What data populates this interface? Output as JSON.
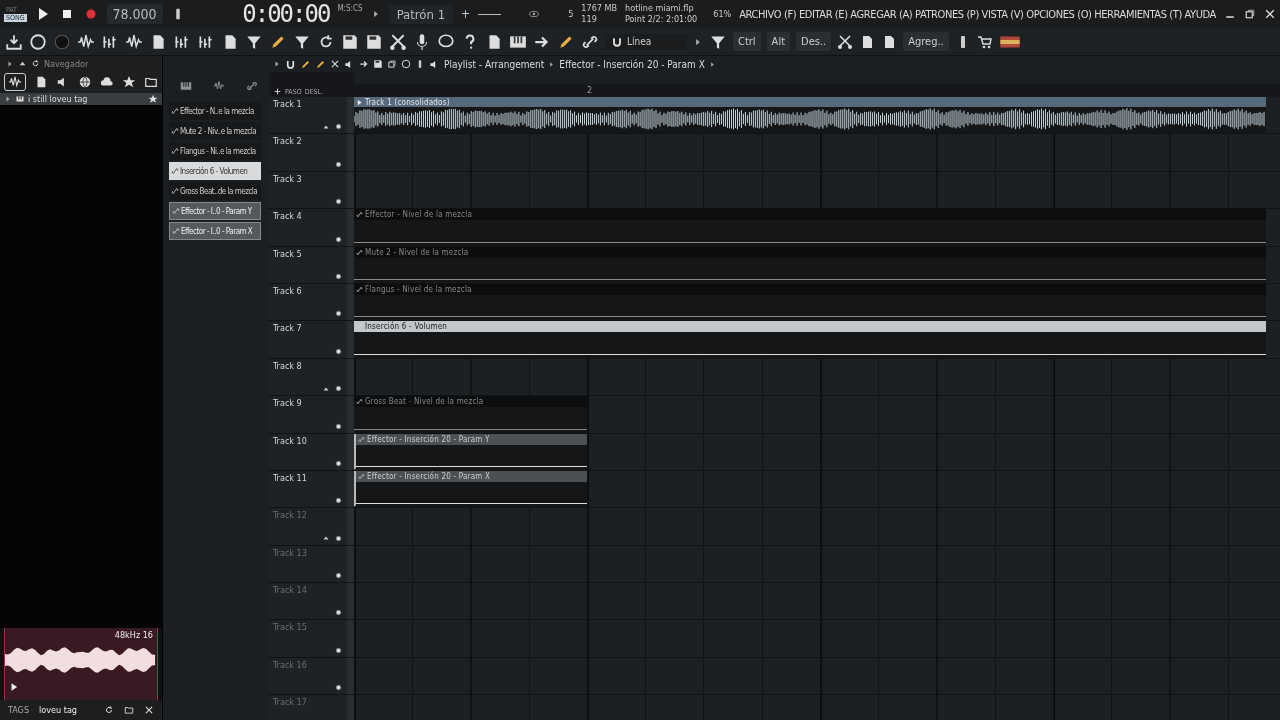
{
  "transport": {
    "mode_labels": [
      {
        "label": "PAT",
        "selected": false
      },
      {
        "label": "SONG",
        "selected": true
      }
    ],
    "recording": true,
    "tempo": "78.000",
    "time": "0:00:00",
    "time_unit": "M:S:CS",
    "pattern": "Patrón 1",
    "pattern_add": "+",
    "step_value": "5",
    "memory": "1767 MB",
    "polyphony": "119",
    "project_file": "hotline miami.flp",
    "hint": "Point 2/2: 2:01:00",
    "cpu": "61%"
  },
  "menu": "ARCHIVO (F) EDITAR (E) AGREGAR (A) PATRONES (P) VISTA (V) OPCIONES (O) HERRAMIENTAS (T) AYUDA",
  "toolbar": {
    "snap": "Línea",
    "buttons": [
      "Ctrl",
      "Alt",
      "Des..",
      "Agreg.."
    ]
  },
  "browser": {
    "title": "Navegador",
    "items": [
      {
        "label": "i still loveu tag",
        "selected": true
      }
    ],
    "preview": {
      "format": "48kHz 16"
    },
    "tags_label": "TAGS",
    "tags": "loveu tag"
  },
  "picker": {
    "items": [
      {
        "label": "Effector - N..e la mezcla",
        "selected": false,
        "highlighted": false
      },
      {
        "label": "Mute 2 - Niv..e la mezcla",
        "selected": false,
        "highlighted": false
      },
      {
        "label": "Flangus - Ni..e la mezcla",
        "selected": false,
        "highlighted": false
      },
      {
        "label": "Inserción 6 - Volumen",
        "selected": false,
        "highlighted": true
      },
      {
        "label": "Gross Beat..de la mezcla",
        "selected": false,
        "highlighted": false
      },
      {
        "label": "Effector - I..0 - Param Y",
        "selected": true,
        "highlighted": false
      },
      {
        "label": "Effector - I..0 - Param X",
        "selected": true,
        "highlighted": false
      }
    ]
  },
  "playlist": {
    "breadcrumb": [
      "Playlist - Arrangement",
      "Effector - Inserción 20 - Param X"
    ],
    "step_label": "PASO",
    "slide_label": "DESL.",
    "ruler": [
      "2"
    ],
    "tracks": [
      {
        "name": "Track 1",
        "dimmed": false,
        "expand_arrow": true,
        "clip": {
          "kind": "audio",
          "label": "Track 1 (consolidados)",
          "full_length": true,
          "selected": false,
          "highlighted": false
        }
      },
      {
        "name": "Track 2",
        "dimmed": false,
        "expand_arrow": false
      },
      {
        "name": "Track 3",
        "dimmed": false,
        "expand_arrow": false
      },
      {
        "name": "Track 4",
        "dimmed": false,
        "expand_arrow": false,
        "clip": {
          "kind": "automation",
          "label": "Effector - Nivel de la mezcla",
          "full_length": true,
          "selected": false,
          "highlighted": false
        }
      },
      {
        "name": "Track 5",
        "dimmed": false,
        "expand_arrow": false,
        "clip": {
          "kind": "automation",
          "label": "Mute 2 - Nivel de la mezcla",
          "full_length": true,
          "selected": false,
          "highlighted": false
        }
      },
      {
        "name": "Track 6",
        "dimmed": false,
        "expand_arrow": false,
        "clip": {
          "kind": "automation",
          "label": "Flangus - Nivel de la mezcla",
          "full_length": true,
          "selected": false,
          "highlighted": false
        }
      },
      {
        "name": "Track 7",
        "dimmed": false,
        "expand_arrow": false,
        "clip": {
          "kind": "automation",
          "label": "Inserción 6 - Volumen",
          "full_length": true,
          "selected": false,
          "highlighted": true
        }
      },
      {
        "name": "Track 8",
        "dimmed": false,
        "expand_arrow": true
      },
      {
        "name": "Track 9",
        "dimmed": false,
        "expand_arrow": false,
        "clip": {
          "kind": "automation",
          "label": "Gross Beat - Nivel de la mezcla",
          "full_length": false,
          "selected": false,
          "highlighted": false
        }
      },
      {
        "name": "Track 10",
        "dimmed": false,
        "expand_arrow": false,
        "clip": {
          "kind": "automation",
          "label": "Effector - Inserción 20 - Param Y",
          "full_length": false,
          "selected": true,
          "highlighted": false
        }
      },
      {
        "name": "Track 11",
        "dimmed": false,
        "expand_arrow": false,
        "clip": {
          "kind": "automation",
          "label": "Effector - Inserción 20 - Param X",
          "full_length": false,
          "selected": true,
          "highlighted": false
        }
      },
      {
        "name": "Track 12",
        "dimmed": true,
        "expand_arrow": true
      },
      {
        "name": "Track 13",
        "dimmed": true,
        "expand_arrow": false
      },
      {
        "name": "Track 14",
        "dimmed": true,
        "expand_arrow": false
      },
      {
        "name": "Track 15",
        "dimmed": true,
        "expand_arrow": false
      },
      {
        "name": "Track 16",
        "dimmed": true,
        "expand_arrow": false
      },
      {
        "name": "Track 17",
        "dimmed": true,
        "expand_arrow": false
      }
    ]
  }
}
